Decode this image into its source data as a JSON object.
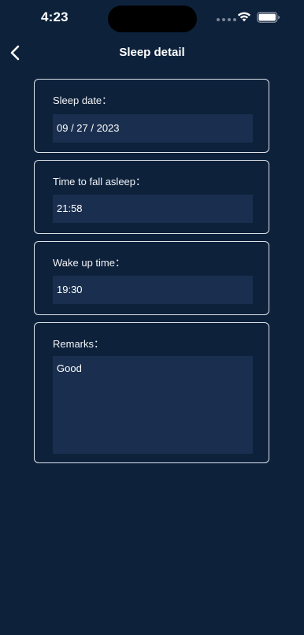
{
  "status_bar": {
    "time": "4:23"
  },
  "nav": {
    "title": "Sleep detail",
    "back_icon": "chevron-left-icon"
  },
  "form": {
    "sleep_date": {
      "label": "Sleep date：",
      "value": "09 / 27 / 2023"
    },
    "fall_asleep": {
      "label": "Time to fall asleep：",
      "value": "21:58"
    },
    "wake_up": {
      "label": "Wake up time：",
      "value": "19:30"
    },
    "remarks": {
      "label": "Remarks：",
      "value": "Good"
    }
  },
  "colors": {
    "background": "#0d213b",
    "field_background": "#1a2f4f",
    "card_border": "#dfe4ea"
  }
}
